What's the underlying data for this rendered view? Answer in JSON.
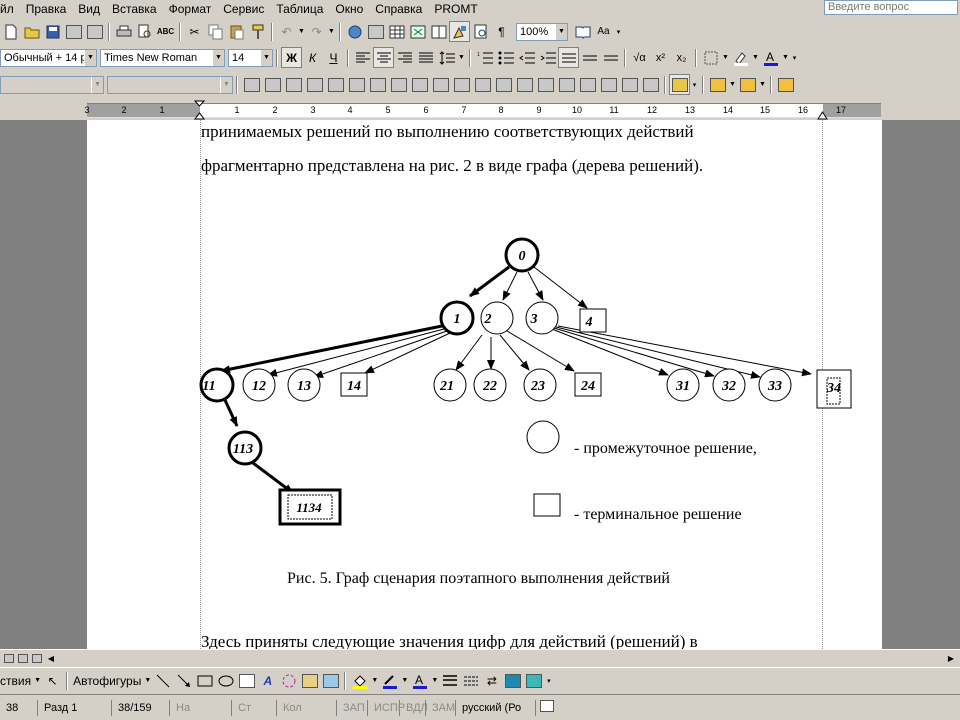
{
  "menu": [
    "йл",
    "Правка",
    "Вид",
    "Вставка",
    "Формат",
    "Сервис",
    "Таблица",
    "Окно",
    "Справка",
    "PROMT"
  ],
  "ask_placeholder": "Введите вопрос",
  "formatting": {
    "style": "Обычный + 14 р",
    "font": "Times New Roman",
    "size": "14",
    "zoom": "100%",
    "bold": "Ж",
    "italic": "К",
    "underline": "Ч",
    "pilcrow": "¶",
    "read_label": "Aa"
  },
  "ruler": {
    "numbers": [
      "3",
      "2",
      "1",
      "1",
      "2",
      "3",
      "4",
      "5",
      "6",
      "7",
      "8",
      "9",
      "10",
      "11",
      "12",
      "13",
      "14",
      "15",
      "16",
      "17"
    ]
  },
  "document": {
    "line1": "принимаемых решений по выполнению соответствующих действий",
    "line2": "фрагментарно представлена на рис. 2 в виде графа (дерева решений).",
    "caption": "Рис. 5. Граф сценария поэтапного выполнения действий",
    "line_bottom": "Здесь приняты следующие значения цифр для действий (решений) в",
    "legend_intermediate": "- промежуточное решение,",
    "legend_terminal": "- терминальное решение"
  },
  "graph": {
    "nodes": [
      "0",
      "1",
      "2",
      "3",
      "4",
      "11",
      "12",
      "13",
      "14",
      "21",
      "22",
      "23",
      "24",
      "31",
      "32",
      "33",
      "34",
      "113",
      "1134"
    ],
    "terminal_nodes": [
      "4",
      "14",
      "24",
      "34",
      "1134"
    ],
    "highlighted_path": [
      "0",
      "1",
      "11",
      "113",
      "1134"
    ]
  },
  "drawing": {
    "actions_label": "ствия",
    "autoshapes_label": "Автофигуры"
  },
  "status": {
    "page": "38",
    "section": "Разд  1",
    "pages": "38/159",
    "at": "На",
    "line": "Ст",
    "col": "Кол",
    "rec": "ЗАП",
    "trk": "ИСПР",
    "ext": "ВДЛ",
    "ovr": "ЗАМ",
    "lang": "русский (Ро"
  }
}
